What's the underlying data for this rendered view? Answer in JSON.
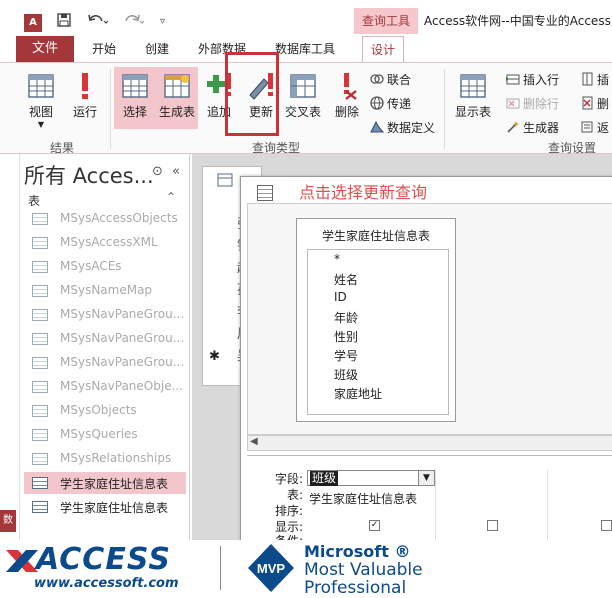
{
  "window": {
    "app_logo": "A",
    "context_tab_label": "查询工具",
    "title": "Access软件网--中国专业的Access交"
  },
  "quick_access": {
    "icons": [
      "save-icon",
      "undo-icon",
      "redo-icon",
      "customize-icon"
    ]
  },
  "ribbon_tabs": {
    "file": "文件",
    "items": [
      "开始",
      "创建",
      "外部数据",
      "数据库工具"
    ],
    "active": "设计"
  },
  "ribbon": {
    "results_group": {
      "label": "结果",
      "buttons": {
        "view": "视图",
        "run": "运行"
      }
    },
    "query_type_group": {
      "label": "查询类型",
      "buttons": {
        "select": "选择",
        "make_table": "生成表",
        "append": "追加",
        "update": "更新",
        "crosstab": "交叉表",
        "delete": "删除"
      },
      "small": {
        "union": "联合",
        "pass_through": "传递",
        "data_definition": "数据定义"
      }
    },
    "query_setup_group": {
      "label": "查询设置",
      "show_table": "显示表",
      "small": {
        "insert_row": "插入行",
        "delete_row": "删除行",
        "builder": "生成器"
      },
      "small_right": {
        "insert": "插",
        "delete": "删",
        "return": "返"
      }
    }
  },
  "nav_pane": {
    "title": "所有 Acces...",
    "section": "表",
    "items": [
      {
        "label": "MSysAccessObjects",
        "user": false
      },
      {
        "label": "MSysAccessXML",
        "user": false
      },
      {
        "label": "MSysACEs",
        "user": false
      },
      {
        "label": "MSysNameMap",
        "user": false
      },
      {
        "label": "MSysNavPaneGrou...",
        "user": false
      },
      {
        "label": "MSysNavPaneGrou...",
        "user": false
      },
      {
        "label": "MSysNavPaneGrou...",
        "user": false
      },
      {
        "label": "MSysNavPaneObje...",
        "user": false
      },
      {
        "label": "MSysObjects",
        "user": false
      },
      {
        "label": "MSysQueries",
        "user": false
      },
      {
        "label": "MSysRelationships",
        "user": false
      },
      {
        "label": "学生家庭住址信息表",
        "user": true,
        "selected": true
      },
      {
        "label": "学生家庭住址信息表",
        "user": true,
        "selected": false
      }
    ]
  },
  "left_strip": {
    "red_label": "数"
  },
  "datasheet_fragment": {
    "cells": [
      "张",
      "钱",
      "赵",
      "孙",
      "李",
      "周",
      "吴"
    ]
  },
  "query_design": {
    "annotation": "点击选择更新查询",
    "table_title": "学生家庭住址信息表",
    "fields": [
      "*",
      "姓名",
      "ID",
      "年龄",
      "性别",
      "学号",
      "班级",
      "家庭地址"
    ],
    "grid": {
      "labels": {
        "field": "字段:",
        "table": "表:",
        "sort": "排序:",
        "show": "显示:",
        "criteria": "条件:"
      },
      "field_value": "班级",
      "table_value": "学生家庭住址信息表",
      "show_checked": [
        true,
        false,
        false
      ]
    }
  },
  "footer": {
    "access_logo": "ACCESS",
    "access_url": "www.accessoft.com",
    "mvp_badge": "MVP",
    "mvp_line1": "Microsoft ®",
    "mvp_line2": "Most Valuable",
    "mvp_line3": "Professional"
  },
  "colors": {
    "accent": "#a4373a",
    "highlight": "#c9313b",
    "annotation": "#e0504e",
    "brand_blue": "#0b4a8b"
  }
}
